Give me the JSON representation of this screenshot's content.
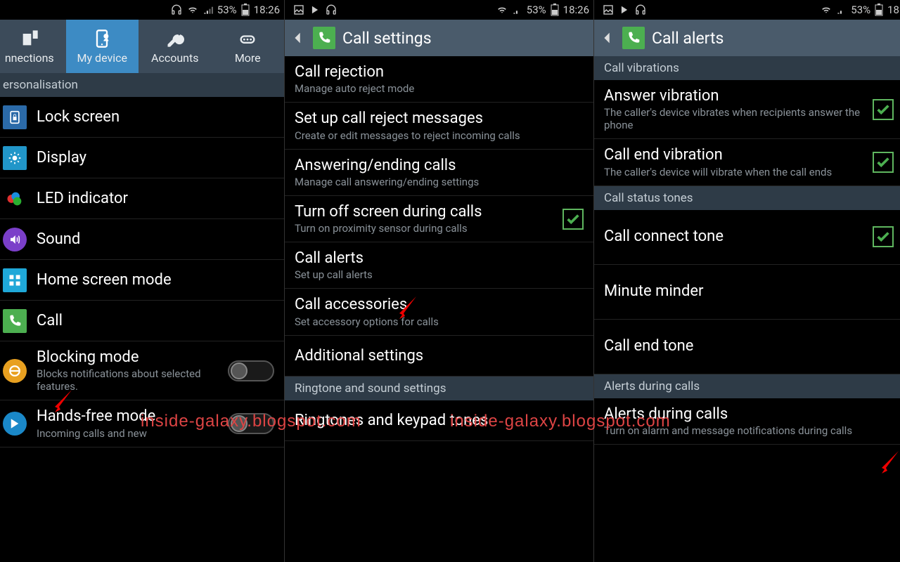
{
  "statusbar": {
    "battery": "53%",
    "time": "18:26",
    "time3": "18"
  },
  "panel1": {
    "tabs": [
      {
        "label": "nnections"
      },
      {
        "label": "My device",
        "active": true
      },
      {
        "label": "Accounts"
      },
      {
        "label": "More"
      }
    ],
    "section1": "ersonalisation",
    "items": [
      {
        "title": "Lock screen"
      },
      {
        "title": "Display"
      },
      {
        "title": "LED indicator"
      },
      {
        "title": "Sound"
      },
      {
        "title": "Home screen mode"
      },
      {
        "title": "Call"
      },
      {
        "title": "Blocking mode",
        "sub": "Blocks notifications about selected features.",
        "toggle": "off"
      },
      {
        "title": "Hands-free mode",
        "sub": "Incoming calls and new",
        "toggle": "off"
      }
    ]
  },
  "panel2": {
    "title": "Call settings",
    "items": [
      {
        "title": "Call rejection",
        "sub": "Manage auto reject mode"
      },
      {
        "title": "Set up call reject messages",
        "sub": "Create or edit messages to reject incoming calls"
      },
      {
        "title": "Answering/ending calls",
        "sub": "Manage call answering/ending settings"
      },
      {
        "title": "Turn off screen during calls",
        "sub": "Turn on proximity sensor during calls",
        "check": true
      },
      {
        "title": "Call alerts",
        "sub": "Set up call alerts"
      },
      {
        "title": "Call accessories",
        "sub": "Set accessory options for calls"
      },
      {
        "title": "Additional settings"
      }
    ],
    "section2": "Ringtone and sound settings",
    "items2": [
      {
        "title": "Ringtones and keypad tones"
      }
    ]
  },
  "panel3": {
    "title": "Call alerts",
    "section1": "Call vibrations",
    "items1": [
      {
        "title": "Answer vibration",
        "sub": "The caller's device vibrates when recipients answer the phone",
        "check": true
      },
      {
        "title": "Call end vibration",
        "sub": "The caller's device will vibrate when the call ends",
        "check": true
      }
    ],
    "section2": "Call status tones",
    "items2": [
      {
        "title": "Call connect tone",
        "check": true
      },
      {
        "title": "Minute minder"
      },
      {
        "title": "Call end tone"
      }
    ],
    "section3": "Alerts during calls",
    "items3": [
      {
        "title": "Alerts during calls",
        "sub": "Turn on alarm and message notifications during calls"
      }
    ]
  },
  "watermark": "inside-galaxy.blogspot.com"
}
